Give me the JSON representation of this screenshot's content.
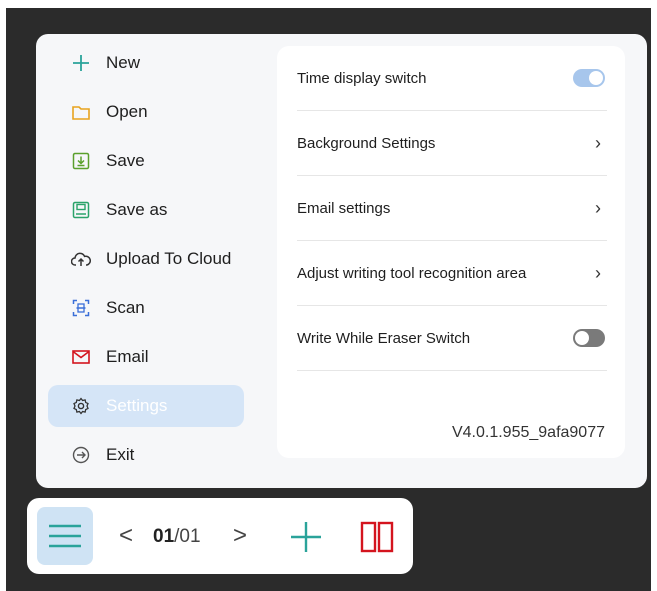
{
  "menu": {
    "items": [
      {
        "label": "New",
        "icon": "plus-icon"
      },
      {
        "label": "Open",
        "icon": "folder-icon"
      },
      {
        "label": "Save",
        "icon": "save-icon"
      },
      {
        "label": "Save as",
        "icon": "save-as-icon"
      },
      {
        "label": "Upload To Cloud",
        "icon": "cloud-upload-icon"
      },
      {
        "label": "Scan",
        "icon": "scan-icon"
      },
      {
        "label": "Email",
        "icon": "email-icon"
      },
      {
        "label": "Settings",
        "icon": "gear-icon",
        "active": true
      },
      {
        "label": "Exit",
        "icon": "exit-icon"
      }
    ]
  },
  "settings": {
    "time_display": {
      "label": "Time display switch",
      "enabled": true
    },
    "background": {
      "label": "Background Settings"
    },
    "email": {
      "label": "Email settings"
    },
    "recognition_area": {
      "label": "Adjust writing tool recognition area"
    },
    "write_eraser": {
      "label": "Write While Eraser Switch",
      "enabled": false
    },
    "version": "V4.0.1.955_9afa9077"
  },
  "toolbar": {
    "current_page": "01",
    "separator": "/",
    "total_pages": "01",
    "prev_label": "<",
    "next_label": ">"
  },
  "colors": {
    "accent": "#2aa39a",
    "active_bg": "#d5e5f7",
    "toggle_on": "#a7c6ec",
    "danger": "#d4141e"
  }
}
